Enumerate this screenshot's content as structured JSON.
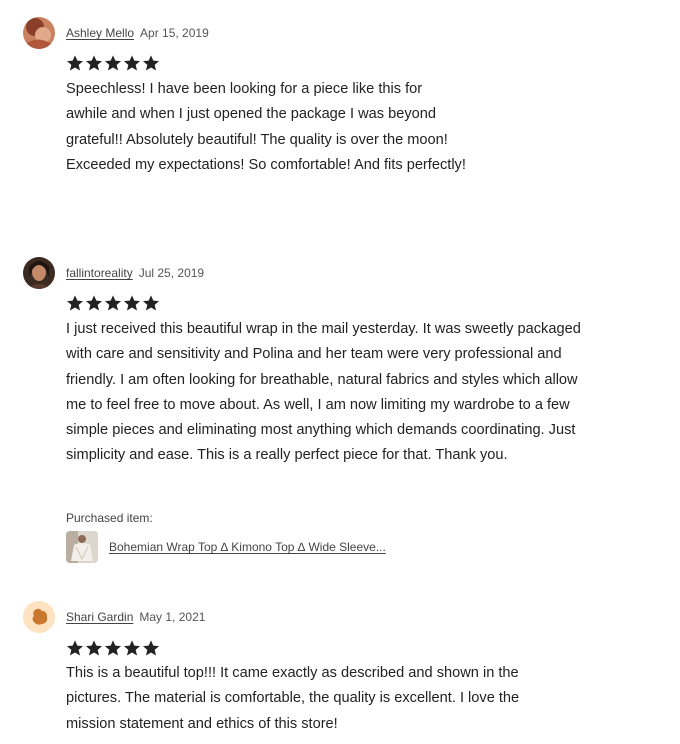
{
  "reviews": [
    {
      "author": "Ashley Mello",
      "date": "Apr 15, 2019",
      "rating": 5,
      "text": "Speechless! I have been looking for a piece like this for awhile and when I just opened the package I was beyond grateful!! Absolutely beautiful! The quality is over the moon! Exceeded my expectations! So comfortable! And fits perfectly!",
      "avatar_icon": "user-photo-icon"
    },
    {
      "author": "fallintoreality",
      "date": "Jul 25, 2019",
      "rating": 5,
      "text": "I just received this beautiful wrap in the mail yesterday. It was sweetly packaged with care and sensitivity and Polina and her team were very professional and friendly. I am often looking for breathable, natural fabrics and styles which allow me to feel free to move about. As well, I am now limiting my wardrobe to a few simple pieces and eliminating most anything which demands coordinating. Just simplicity and ease. This is a really perfect piece for that. Thank you.",
      "purchased_label": "Purchased item:",
      "purchased_item": "Bohemian Wrap Top ∆ Kimono Top ∆ Wide Sleeve...",
      "avatar_icon": "user-photo-icon"
    },
    {
      "author": "Shari Gardin",
      "date": "May 1, 2021",
      "rating": 5,
      "text": "This is a beautiful top!!! It came exactly as described and shown in the pictures. The material is comfortable, the quality is excellent. I love the mission statement and ethics of this store!",
      "avatar_icon": "default-avatar-icon"
    }
  ],
  "colors": {
    "star": "#222222",
    "text": "#222222",
    "default_avatar_bg": "#fde3c2",
    "default_avatar_fg": "#c9782f"
  }
}
